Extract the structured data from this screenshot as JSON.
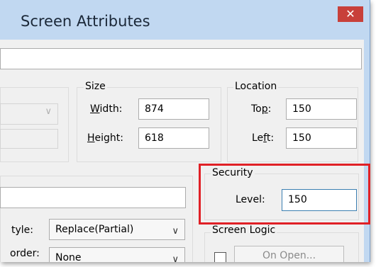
{
  "window": {
    "title": "Screen Attributes",
    "close_glyph": "✕"
  },
  "size": {
    "legend": "Size",
    "width": {
      "label_u": "W",
      "label_rest": "idth:",
      "value": "874"
    },
    "height": {
      "label_u": "H",
      "label_rest": "eight:",
      "value": "618"
    }
  },
  "location": {
    "legend": "Location",
    "top": {
      "label_pre": "To",
      "label_u": "p",
      "label_post": ":",
      "value": "150"
    },
    "left": {
      "label_pre": "Le",
      "label_u": "f",
      "label_post": "t:",
      "value": "150"
    }
  },
  "security": {
    "legend": "Security",
    "level_label": "Level:",
    "level_value": "150"
  },
  "options": {
    "style_label_partial": "tyle:",
    "style_value": "Replace(Partial)",
    "border_label_partial": "order:",
    "border_value": "None"
  },
  "screen_logic": {
    "legend": "Screen Logic",
    "on_open_label": "On Open..."
  },
  "icons": {
    "dropdown": "chevron-down-icon",
    "close": "close-icon"
  },
  "colors": {
    "highlight": "#e02026",
    "titlebar": "#c1d8f1",
    "close": "#c8403a"
  }
}
